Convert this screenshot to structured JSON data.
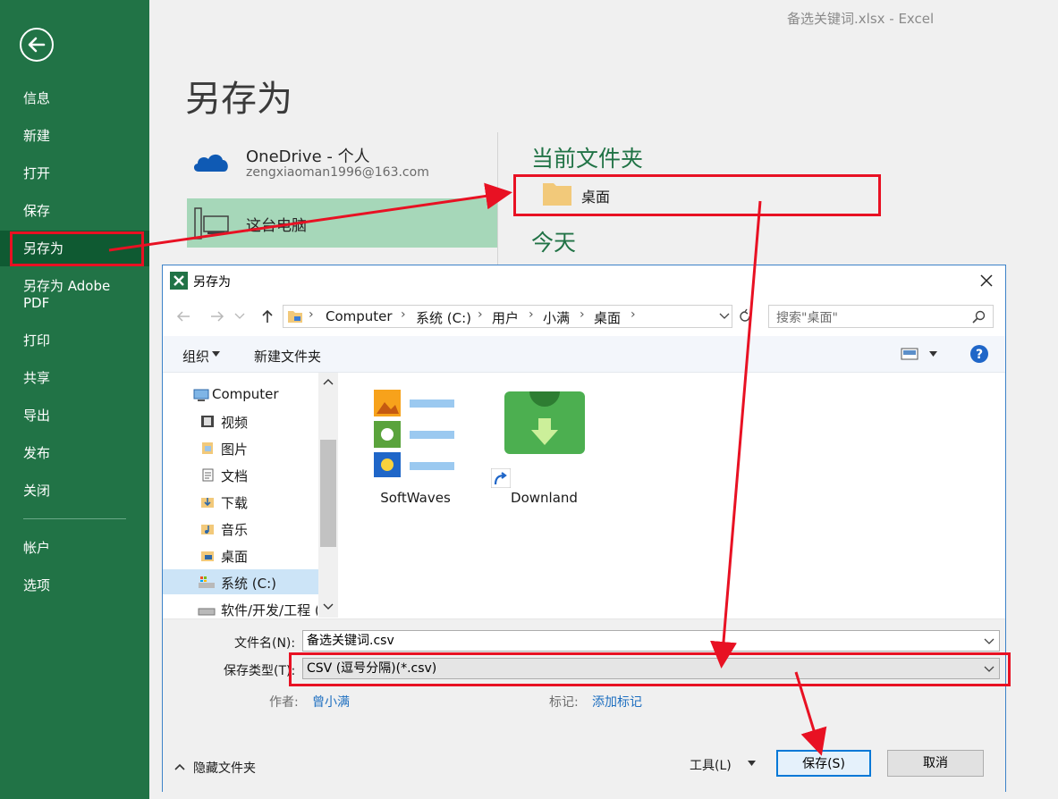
{
  "window_title": "备选关键词.xlsx - Excel",
  "backstage": {
    "page_title": "另存为",
    "menu": [
      {
        "label": "信息"
      },
      {
        "label": "新建"
      },
      {
        "label": "打开"
      },
      {
        "label": "保存"
      },
      {
        "label": "另存为"
      },
      {
        "label": "另存为 Adobe PDF"
      },
      {
        "label": "打印"
      },
      {
        "label": "共享"
      },
      {
        "label": "导出"
      },
      {
        "label": "发布"
      },
      {
        "label": "关闭"
      },
      {
        "label": "帐户"
      },
      {
        "label": "选项"
      }
    ],
    "locations": {
      "onedrive_title": "OneDrive - 个人",
      "onedrive_email": "zengxiaoman1996@163.com",
      "this_pc": "这台电脑"
    },
    "current_folder_heading": "当前文件夹",
    "current_folder": "桌面",
    "today_heading": "今天"
  },
  "dialog": {
    "title": "另存为",
    "breadcrumb": [
      "Computer",
      "系统 (C:)",
      "用户",
      "小满",
      "桌面"
    ],
    "search_placeholder": "搜索\"桌面\"",
    "toolbar": {
      "organize": "组织",
      "new_folder": "新建文件夹"
    },
    "nav": [
      "Computer",
      "视频",
      "图片",
      "文档",
      "下载",
      "音乐",
      "桌面",
      "系统 (C:)",
      "软件/开发/工程 ("
    ],
    "files": [
      {
        "name": "SoftWaves"
      },
      {
        "name": "Downland"
      }
    ],
    "filename_label": "文件名(N):",
    "filename_value": "备选关键词.csv",
    "type_label": "保存类型(T):",
    "type_value": "CSV (逗号分隔)(*.csv)",
    "author_label": "作者:",
    "author_value": "曾小满",
    "tags_label": "标记:",
    "tags_value": "添加标记",
    "hide_folders": "隐藏文件夹",
    "tools": "工具(L)",
    "save": "保存(S)",
    "cancel": "取消"
  },
  "colors": {
    "excel_green": "#217346",
    "annotation_red": "#e81123",
    "link_blue": "#1e6fc0"
  }
}
